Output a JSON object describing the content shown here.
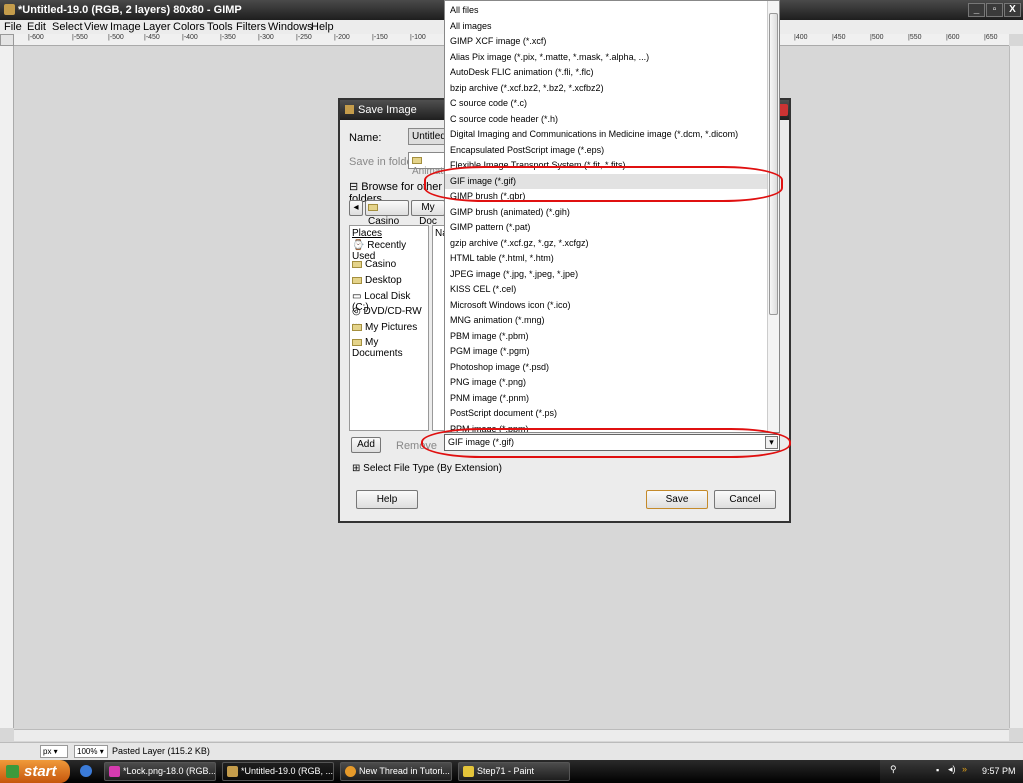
{
  "window": {
    "title": "*Untitled-19.0 (RGB, 2 layers) 80x80 - GIMP",
    "controls": [
      "_",
      "▫",
      "X"
    ]
  },
  "menubar": [
    "File",
    "Edit",
    "Select",
    "View",
    "Image",
    "Layer",
    "Colors",
    "Tools",
    "Filters",
    "Windows",
    "Help"
  ],
  "ruler_top": [
    "|-600",
    "|-550",
    "|-500",
    "|-450",
    "|-400",
    "|-350",
    "|-300",
    "|-250",
    "|-200",
    "|-150",
    "|-100",
    "|400",
    "|450",
    "|500",
    "|550",
    "|600",
    "|650"
  ],
  "dialog": {
    "title": "Save Image",
    "name_label": "Name:",
    "name_value": "Untitled",
    "save_in_label": "Save in folder:",
    "save_in_value": "Animati",
    "browse_label": "Browse for other folders",
    "path_buttons": [
      "Casino",
      "My Doc"
    ],
    "places_header": "Places",
    "name_col_header": "Na",
    "places": [
      "Recently Used",
      "Casino",
      "Desktop",
      "Local Disk (C:)",
      "DVD/CD-RW ...",
      "My Pictures",
      "My Documents"
    ],
    "add_label": "Add",
    "remove_label": "Remove",
    "select_type_label": "Select File Type (By Extension)",
    "help_label": "Help",
    "save_label": "Save",
    "cancel_label": "Cancel"
  },
  "file_types": [
    "All files",
    "All images",
    "GIMP XCF image (*.xcf)",
    "Alias Pix image (*.pix, *.matte, *.mask, *.alpha, ...)",
    "AutoDesk FLIC animation (*.fli, *.flc)",
    "bzip archive (*.xcf.bz2, *.bz2, *.xcfbz2)",
    "C source code (*.c)",
    "C source code header (*.h)",
    "Digital Imaging and Communications in Medicine image (*.dcm, *.dicom)",
    "Encapsulated PostScript image (*.eps)",
    "Flexible Image Transport System (*.fit, *.fits)",
    "GIF image (*.gif)",
    "GIMP brush (*.gbr)",
    "GIMP brush (animated) (*.gih)",
    "GIMP pattern (*.pat)",
    "gzip archive (*.xcf.gz, *.gz, *.xcfgz)",
    "HTML table (*.html, *.htm)",
    "JPEG image (*.jpg, *.jpeg, *.jpe)",
    "KISS CEL (*.cel)",
    "Microsoft Windows icon (*.ico)",
    "MNG animation (*.mng)",
    "PBM image (*.pbm)",
    "PGM image (*.pgm)",
    "Photoshop image (*.psd)",
    "PNG image (*.png)",
    "PNM image (*.pnm)",
    "PostScript document (*.ps)",
    "PPM image (*.ppm)"
  ],
  "selected_file_type": "GIF image (*.gif)",
  "statusbar": {
    "unit": "px",
    "zoom": "100%",
    "message": "Pasted Layer (115.2 KB)"
  },
  "taskbar": {
    "start_label": "start",
    "tasks": [
      "*Lock.png-18.0 (RGB...",
      "*Untitled-19.0 (RGB, ...",
      "New Thread in Tutori...",
      "Step71 - Paint"
    ],
    "clock": "9:57 PM"
  },
  "colors": {
    "highlight_ring": "#e01010",
    "start_button": "#e37a22"
  }
}
